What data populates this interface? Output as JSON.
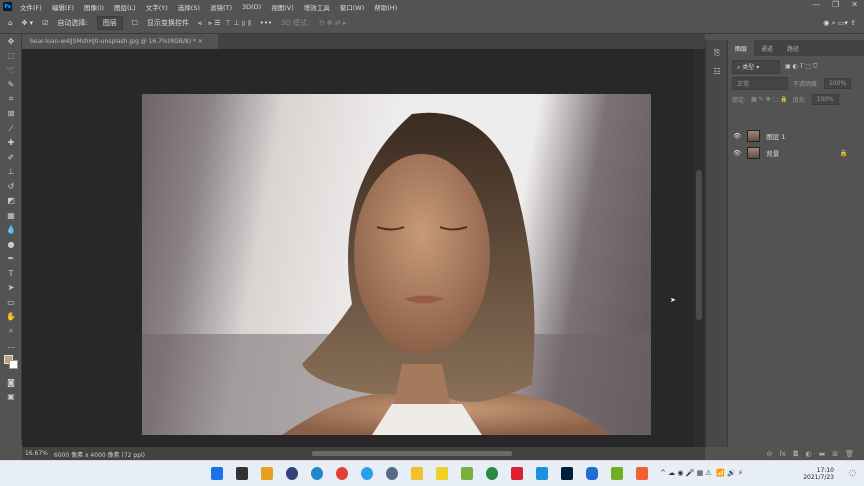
{
  "app": {
    "logo": "Ps"
  },
  "menu": [
    "文件(F)",
    "编辑(E)",
    "图像(I)",
    "图层(L)",
    "文字(Y)",
    "选择(S)",
    "滤镜(T)",
    "3D(D)",
    "视图(V)",
    "增效工具",
    "窗口(W)",
    "帮助(H)"
  ],
  "options": {
    "auto_select": "自动选择:",
    "auto_select_value": "图层",
    "show_transform": "显示变换控件",
    "more": "•••",
    "mode_3d": "3D 模式:"
  },
  "document": {
    "tab_title": "bear-loan-w4lJSMshHJ0-unsplash.jpg @ 16.7%(RGB/8) *",
    "zoom": "16.67%",
    "info": "6000 像素 x 4000 像素 (72 ppi)"
  },
  "layers_panel": {
    "tabs": [
      "图层",
      "通道",
      "路径"
    ],
    "filter": "类型",
    "blend_mode": "正常",
    "opacity_label": "不透明度:",
    "opacity": "100%",
    "lock_label": "锁定:",
    "fill_label": "填充:",
    "fill": "100%",
    "layers": [
      {
        "name": "图层 1",
        "selected": false
      },
      {
        "name": "背景",
        "selected": false
      }
    ]
  },
  "taskbar": {
    "time": "17:10",
    "date": "2021/7/23"
  }
}
